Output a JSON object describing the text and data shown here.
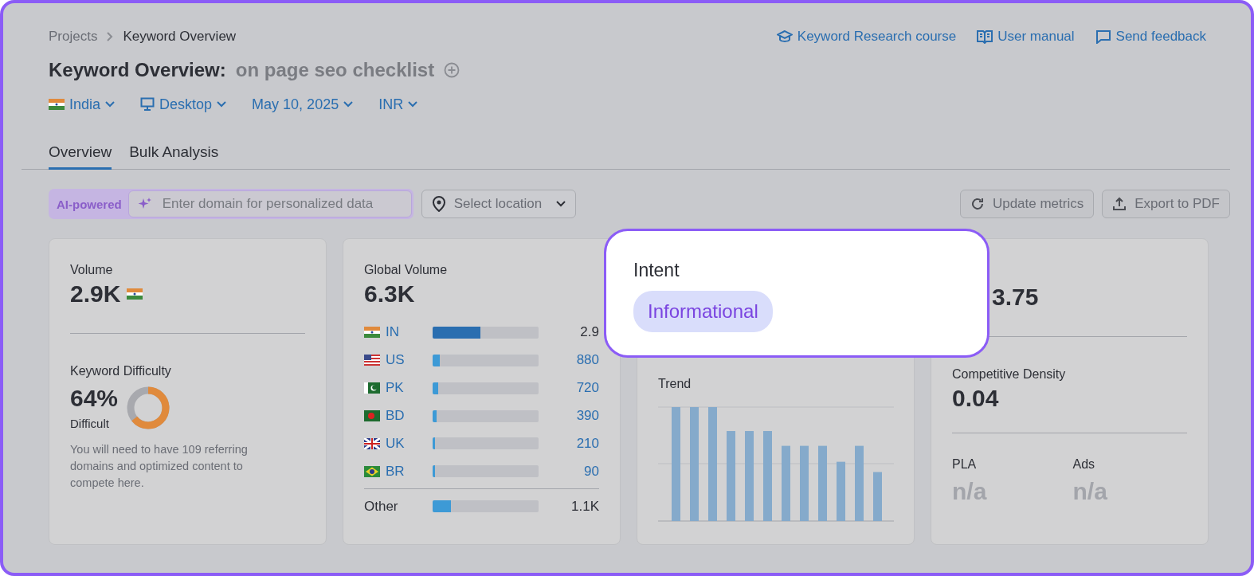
{
  "breadcrumbs": [
    {
      "label": "Projects"
    },
    {
      "label": "Keyword Overview"
    }
  ],
  "header_links": [
    {
      "label": "Keyword Research course"
    },
    {
      "label": "User manual"
    },
    {
      "label": "Send feedback"
    }
  ],
  "title": {
    "prefix": "Keyword Overview:",
    "keyword": "on page seo checklist"
  },
  "filters": [
    {
      "label": "India"
    },
    {
      "label": "Desktop"
    },
    {
      "label": "May 10, 2025"
    },
    {
      "label": "INR"
    }
  ],
  "tabs": [
    {
      "label": "Overview",
      "selected": true
    },
    {
      "label": "Bulk Analysis",
      "selected": false
    }
  ],
  "toolbar": {
    "ai_badge": "AI-powered",
    "domain_placeholder": "Enter domain for personalized data",
    "location_placeholder": "Select location",
    "buttons": [
      {
        "label": "Update metrics"
      },
      {
        "label": "Export to PDF"
      }
    ]
  },
  "volume_card": {
    "label": "Volume",
    "value": "2.9K",
    "difficulty_label": "Keyword Difficulty",
    "difficulty_value": "64%",
    "level": 0.64,
    "difficulty_text": "Difficult",
    "description": "You will need to have 109 referring domains and optimized content to compete here."
  },
  "global_card": {
    "label": "Global Volume",
    "value": "6.3K",
    "countries": [
      {
        "code": "IN",
        "value": "2.9",
        "level": 0.45,
        "selected": true
      },
      {
        "code": "US",
        "value": "880",
        "level": 0.07,
        "selected": false
      },
      {
        "code": "PK",
        "value": "720",
        "level": 0.05,
        "selected": false
      },
      {
        "code": "BD",
        "value": "390",
        "level": 0.04,
        "selected": false
      },
      {
        "code": "UK",
        "value": "210",
        "level": 0.02,
        "selected": false
      },
      {
        "code": "BR",
        "value": "90",
        "level": 0.02,
        "selected": false
      }
    ],
    "other": {
      "label": "Other",
      "value": "1.1K",
      "level": 0.17
    }
  },
  "trend_card": {
    "label": "Trend"
  },
  "cpc_card": {
    "value": "3.75",
    "density_label": "Competitive Density",
    "density_value": "0.04",
    "metrics": [
      {
        "label": "PLA",
        "value": "n/a"
      },
      {
        "label": "Ads",
        "value": "n/a"
      }
    ]
  },
  "intent_popup": {
    "label": "Intent",
    "tag": "Informational"
  }
}
